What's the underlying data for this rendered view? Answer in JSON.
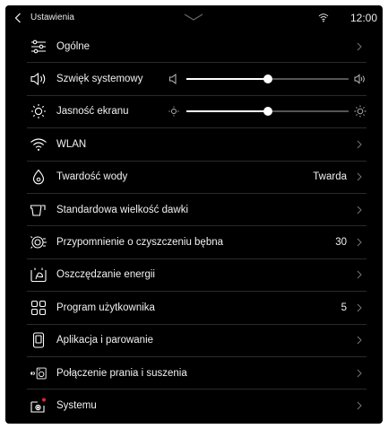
{
  "status_bar": {
    "title": "Ustawienia",
    "time": "12:00"
  },
  "settings": {
    "items": [
      {
        "label": "Ogólne",
        "value": "",
        "icon": "sliders-icon"
      },
      {
        "label": "Szwięk systemowy",
        "value": "",
        "icon": "speaker-icon",
        "slider_level": 0.5
      },
      {
        "label": "Jasność ekranu",
        "value": "",
        "icon": "sun-icon",
        "slider_level": 0.5
      },
      {
        "label": "WLAN",
        "value": "",
        "icon": "wifi-icon"
      },
      {
        "label": "Twardość wody",
        "value": "Twarda",
        "icon": "water-drop-icon"
      },
      {
        "label": "Standardowa wielkość dawki",
        "value": "",
        "icon": "detergent-icon"
      },
      {
        "label": "Przypomnienie o czyszczeniu bębna",
        "value": "30",
        "icon": "drum-clean-icon"
      },
      {
        "label": "Oszczędzanie energii",
        "value": "",
        "icon": "energy-saving-icon"
      },
      {
        "label": "Program użytkownika",
        "value": "5",
        "icon": "grid-icon"
      },
      {
        "label": "Aplikacja i parowanie",
        "value": "",
        "icon": "phone-icon"
      },
      {
        "label": "Połączenie prania i suszenia",
        "value": "",
        "icon": "washer-dryer-link-icon"
      },
      {
        "label": "Systemu",
        "value": "",
        "icon": "system-icon"
      }
    ]
  },
  "colors": {
    "background": "#000000",
    "text": "#f2f2f2",
    "divider": "#2a2a2a",
    "notification_dot": "#e0243a"
  }
}
